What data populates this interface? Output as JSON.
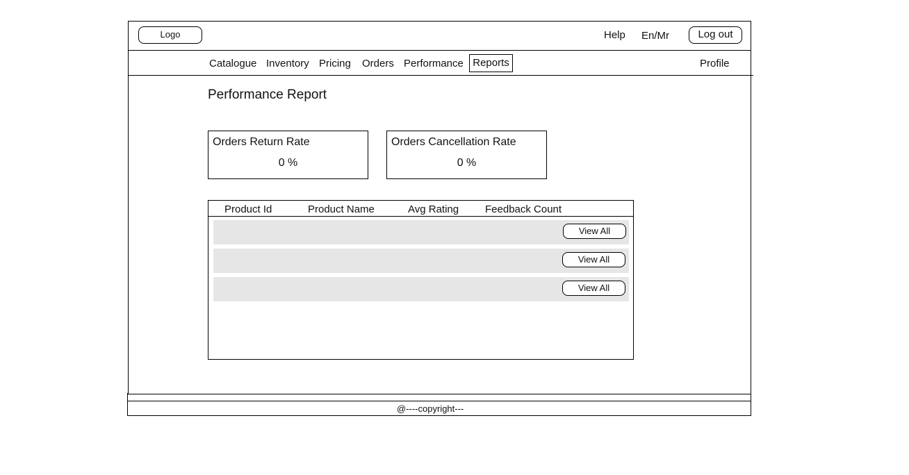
{
  "header": {
    "logo": "Logo",
    "help": "Help",
    "language": "En/Mr",
    "logout": "Log out"
  },
  "nav": {
    "items": [
      "Catalogue",
      "Inventory",
      "Pricing",
      "Orders",
      "Performance"
    ],
    "active": "Reports",
    "profile": "Profile"
  },
  "main": {
    "title": "Performance Report",
    "cards": [
      {
        "label": "Orders Return Rate",
        "value": "0 %"
      },
      {
        "label": "Orders Cancellation Rate",
        "value": "0 %"
      }
    ],
    "table": {
      "columns": [
        "Product Id",
        "Product Name",
        "Avg Rating",
        "Feedback Count"
      ],
      "rows": [
        {
          "action": "View All"
        },
        {
          "action": "View All"
        },
        {
          "action": "View All"
        }
      ]
    }
  },
  "footer": {
    "copyright": "@----copyright---"
  }
}
